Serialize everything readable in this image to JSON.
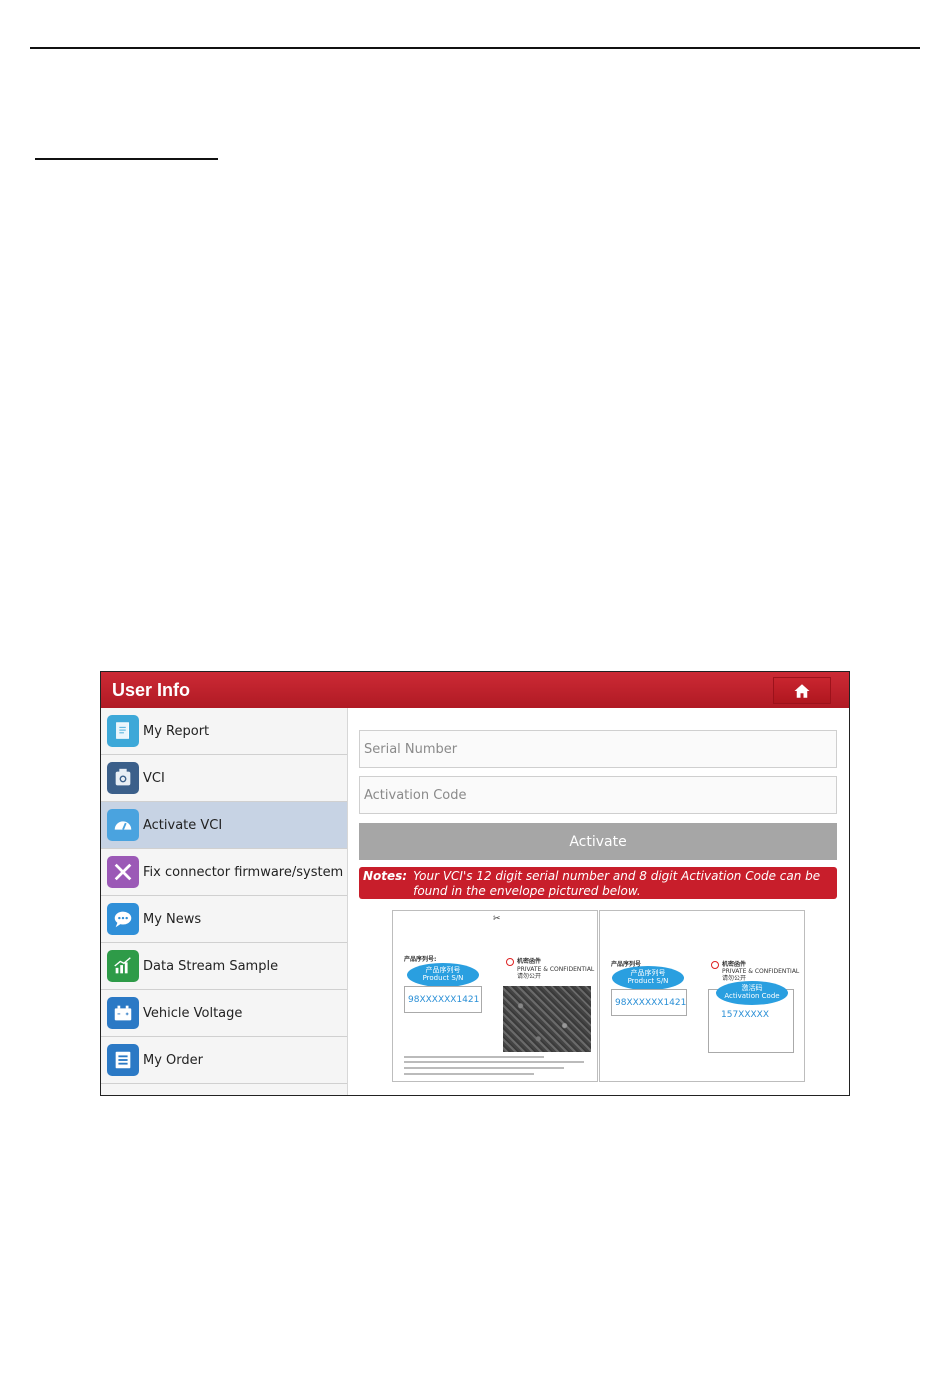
{
  "window": {
    "title": "User Info",
    "home_icon": "home-icon"
  },
  "sidebar": {
    "items": [
      {
        "label": "My Report",
        "icon": "report-icon",
        "color": "#3da8d8"
      },
      {
        "label": "VCI",
        "icon": "vci-icon",
        "color": "#3b5f8a"
      },
      {
        "label": "Activate VCI",
        "icon": "speedometer-icon",
        "color": "#4aa3df",
        "active": true
      },
      {
        "label": "Fix connector firmware/system",
        "icon": "tools-icon",
        "color": "#9b59b6"
      },
      {
        "label": "My News",
        "icon": "chat-icon",
        "color": "#2f8fd8"
      },
      {
        "label": "Data Stream Sample",
        "icon": "chart-icon",
        "color": "#2e9b48"
      },
      {
        "label": "Vehicle Voltage",
        "icon": "battery-icon",
        "color": "#2b79c5"
      },
      {
        "label": "My Order",
        "icon": "order-icon",
        "color": "#2b79c5"
      }
    ]
  },
  "form": {
    "serial_placeholder": "Serial Number",
    "activation_placeholder": "Activation Code",
    "activate_label": "Activate"
  },
  "notes": {
    "label": "Notes:",
    "text": "Your VCI's 12 digit serial number and 8 digit Activation Code can be found in the envelope pictured below."
  },
  "envelope_left": {
    "scissors": "✂",
    "cn_sn_label": "产品序列号:",
    "bubble_cn": "产品序列号",
    "bubble_en": "Product S/N",
    "serial_value": "98XXXXXX1421",
    "private_cn": "机密函件",
    "private_en": "PRIVATE & CONFIDENTIAL",
    "private_sub": "请勿公开"
  },
  "envelope_right": {
    "cn_sn_label": "产品序列号",
    "bubble_cn": "产品序列号",
    "bubble_en": "Product S/N",
    "serial_value": "98XXXXXX1421",
    "private_cn": "机密函件",
    "private_en": "PRIVATE & CONFIDENTIAL",
    "private_sub": "请勿公开",
    "act_bubble_cn": "激活码",
    "act_bubble_en": "Activation Code",
    "activation_value": "157XXXXX"
  }
}
